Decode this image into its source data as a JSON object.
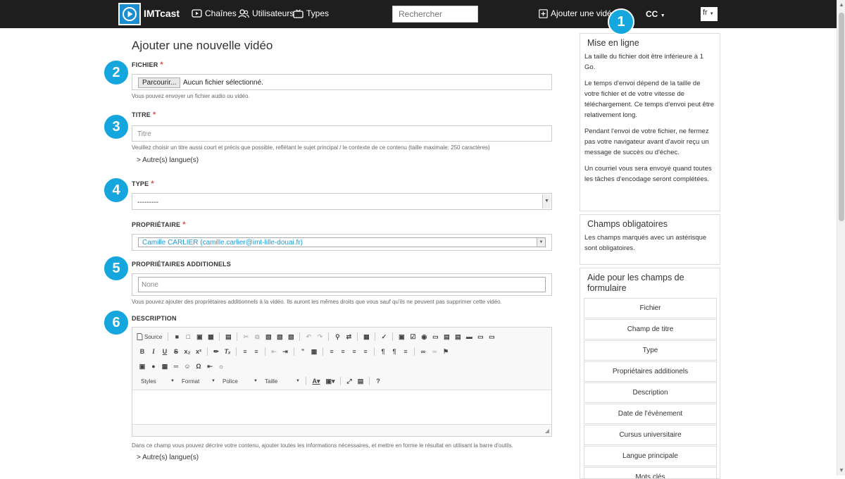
{
  "navbar": {
    "brand": "IMTcast",
    "links": {
      "channels": "Chaînes",
      "users": "Utilisateurs",
      "types": "Types"
    },
    "search_placeholder": "Rechercher",
    "add_video": "Ajouter une vidéo",
    "cc": "CC",
    "lang": "fr"
  },
  "callouts": [
    "1",
    "2",
    "3",
    "4",
    "5",
    "6"
  ],
  "form": {
    "title": "Ajouter une nouvelle vidéo",
    "file": {
      "label": "Fichier",
      "button": "Parcourir...",
      "status": "Aucun fichier sélectionné.",
      "help": "Vous pouvez envoyer un fichier audio ou vidéo."
    },
    "title_field": {
      "label": "Titre",
      "placeholder": "Titre",
      "help": "Veuillez choisir un titre aussi court et précis que possible, reflétant le sujet principal / le contexte de ce contenu (taille maximale: 250 caractères)",
      "other_languages": "> Autre(s) langue(s)"
    },
    "type": {
      "label": "Type",
      "value": "---------"
    },
    "owner": {
      "label": "Propriétaire",
      "value": "Camille CARLIER (camille.carlier@imt-lille-douai.fr)"
    },
    "additional_owners": {
      "label": "Propriétaires additionels",
      "placeholder": "None",
      "help": "Vous pouvez ajouter des propriétaires additionnels à la vidéo. Ils auront les mêmes droits que vous sauf qu'ils ne peuvent pas supprimer cette vidéo."
    },
    "description": {
      "label": "Description",
      "help": "Dans ce champ vous pouvez décrire votre contenu, ajouter toutes les informations nécessaires, et mettre en forme le résultat en utilisant la barre d'outils.",
      "other_languages": "> Autre(s) langue(s)"
    },
    "required_mark": "*"
  },
  "editor": {
    "source_label": "Source",
    "combos": [
      "Styles",
      "Format",
      "Police",
      "Taille"
    ],
    "help_button": "?"
  },
  "sidebar": {
    "upload": {
      "title": "Mise en ligne",
      "paragraphs": [
        "La taille du fichier doit être inférieure à 1 Go.",
        "Le temps d'envoi dépend de la taille de votre fichier et de votre vitesse de téléchargement. Ce temps d'envoi peut être relativement long.",
        "Pendant l'envoi de votre fichier, ne fermez pas votre navigateur avant d'avoir reçu un message de succès ou d'échec.",
        "Un courriel vous sera envoyé quand toutes les tâches d'encodage seront complétées."
      ]
    },
    "required": {
      "title": "Champs obligatoires",
      "text": "Les champs marqués avec un astérisque sont obligatoires."
    },
    "help": {
      "title": "Aide pour les champs de formulaire",
      "items": [
        "Fichier",
        "Champ de titre",
        "Type",
        "Propriétaires additionels",
        "Description",
        "Date de l'évènement",
        "Cursus universitaire",
        "Langue principale",
        "Mots clés"
      ]
    }
  }
}
